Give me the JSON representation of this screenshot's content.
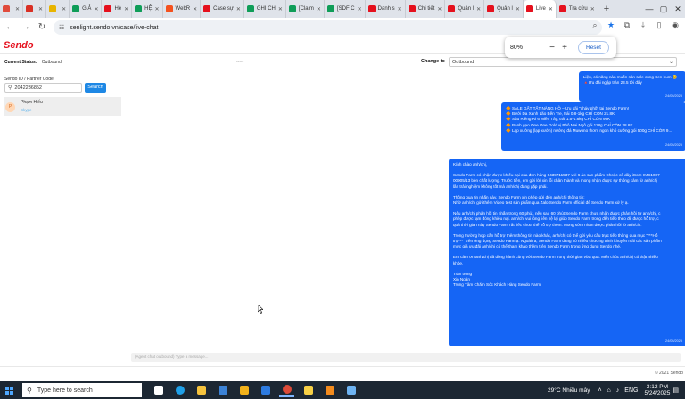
{
  "browser": {
    "tabs": [
      {
        "label": "",
        "color": "#e04b3c",
        "active": false,
        "icon": "gmail-icon"
      },
      {
        "label": "",
        "color": "#d93025",
        "active": false,
        "icon": "gmail-icon"
      },
      {
        "label": "",
        "color": "#e8b400",
        "active": false,
        "icon": "product-icon"
      },
      {
        "label": "GIẢ",
        "color": "#0f9d58",
        "active": false,
        "icon": "sheets-icon"
      },
      {
        "label": "Hệ",
        "color": "#e5101d",
        "active": false,
        "icon": "sendo-icon"
      },
      {
        "label": "HỆ",
        "color": "#0f9d58",
        "active": false,
        "icon": "sheets-icon"
      },
      {
        "label": "WebR",
        "color": "#f4511e",
        "active": false,
        "icon": "webr-icon"
      },
      {
        "label": "Case sự",
        "color": "#e5101d",
        "active": false,
        "icon": "sendo-icon"
      },
      {
        "label": "GHI CH",
        "color": "#0f9d58",
        "active": false,
        "icon": "sheets-icon"
      },
      {
        "label": "[Claim",
        "color": "#0f9d58",
        "active": false,
        "icon": "sheets-icon"
      },
      {
        "label": "[SDF C",
        "color": "#0f9d58",
        "active": false,
        "icon": "sheets-icon"
      },
      {
        "label": "Danh s",
        "color": "#e5101d",
        "active": false,
        "icon": "sendo-icon"
      },
      {
        "label": "Chi tiết",
        "color": "#e5101d",
        "active": false,
        "icon": "sendo-icon"
      },
      {
        "label": "Quản l",
        "color": "#e5101d",
        "active": false,
        "icon": "sendo-icon"
      },
      {
        "label": "Quản l",
        "color": "#e5101d",
        "active": false,
        "icon": "sendo-icon"
      },
      {
        "label": "Live",
        "color": "#e5101d",
        "active": true,
        "icon": "sendo-icon"
      },
      {
        "label": "Tra cứu",
        "color": "#e5101d",
        "active": false,
        "icon": "sendo-icon"
      }
    ],
    "url": "senlight.sendo.vn/case/live-chat",
    "zoom": {
      "percent": "80%",
      "minus": "−",
      "plus": "+",
      "reset_label": "Reset"
    }
  },
  "app": {
    "logo": "Sendo",
    "current_status_label": "Current Status:",
    "current_status_value": "Outbound",
    "status_placeholder": "-----",
    "change_to_label": "Change to",
    "change_to_value": "Outbound",
    "search_label": "Sendo ID / Partner Code",
    "search_value": "2042236852",
    "search_button": "Search",
    "conversation": {
      "name": "Phạm Hiếu",
      "sub": "Skype",
      "avatar": "P"
    },
    "composer_placeholder": "(Agent chat outbound) Type a message...",
    "copyright": "© 2021 Sendo"
  },
  "messages": [
    {
      "lines": [
        "Liệu, có năng nàn muốn sản sale cùng Sen hum 😊",
        "🔺Ưu đãi ngập tràn 23.5 tới đây"
      ],
      "time": "24/05/2025"
    },
    {
      "lines": [
        "🔶 SALE GẤT TẤT NĂNG HỒ – Ưu đãi \"cháy phố\" tại Sendo Farm!",
        "🔶 Bưởi Da Xanh Lão Bến Tre, trái 0.8-1kg CHỈ CÒN 21.8K",
        "🔶 Sầu Riêng Ri 6 Miền Tây, trái 1.5-1.8kg CHỈ CÒN 99K",
        "🔶 Bánh gạo One One Gold vị Phô Mai Ngô gói 118g CHỈ CÒN 28.8K",
        "🔶 Lạp xưởng (lạp xưởn) nướng đá Muwono thơm ngon khó cưỡng gói 500g CHỈ CÒN 9..."
      ],
      "time": "24/05/2025"
    },
    {
      "lines": [
        "Kính chào anh/chị,",
        "",
        "Sendo Farm có nhận được khiếu nại của đơn hàng 0439711537 với 6 áo sản phẩm Choộc cổ dây iCore IMC1007-",
        "00905/13 bên chất lượng. Trước tiên, em gửi lời xin lỗi chân thành và mong nhận được sự thông cảm từ anh/chị",
        "lần trải nghiệm không tốt mà anh/chị đang gặp phải.",
        "",
        "Thông qua tin nhắn này, Sendo Farm xin phép gửi đến anh/chị thông tin:",
        "Nhờ anh/chị gửi thêm Video test sản phẩm qua Zalo Sendo Farm official để Sendo Farm xử lý ạ.",
        "",
        "Nếu anh/chị phản hồi tin nhắn trong 60 phút, nếu sau 60 phút Sendo Farm chưa nhận được phản hồi từ anh/chị, c",
        "phép được tạm đóng khiếu nại. anh/chị vui lòng liên hệ lại giúp Sendo Farm trong đến tiếp theo để được hỗ trợ, c",
        "quá thời gian này Sendo Farm rất tiếc chưa thể hỗ trợ thêm. Mong sớm nhận được phản hồi từ anh/chị.",
        "",
        "Trong trường hợp cần hỗ trợ thêm thông tin nào khác, anh/chị có thể gửi yêu cầu trực tiếp thông qua mục \"***Hỗ",
        "trợ***\" trên ứng dụng Sendo Farm ạ. Ngoài ra, Sendo Farm đang có nhiều chương trình khuyến mãi các sản phẩm",
        "mức giá ưu đãi anh/chị có thể tham khảo thêm trên Sendo Farm trong ứng dụng Sendo nhé.",
        "",
        "Em cảm ơn anh/chị đã đồng hành cùng với Sendo Farm trong thời gian vừa qua. Mến chúc anh/chị có thật nhiều",
        "khỏe.",
        "",
        "Trân trọng",
        "Xin Ngân",
        "Trung Tâm Chăm Sóc Khách Hàng Sendo Farm"
      ],
      "time": "24/05/2025"
    }
  ],
  "taskbar": {
    "search_placeholder": "Type here to search",
    "weather": "29°C  Nhiều mây",
    "language": "ENG",
    "time": "3:12 PM",
    "date": "5/24/2025",
    "apps": [
      {
        "name": "task-view-icon",
        "color": "#ffffff"
      },
      {
        "name": "edge-icon",
        "color": "#1fa0e8"
      },
      {
        "name": "file-explorer-icon",
        "color": "#f4c23d"
      },
      {
        "name": "store-icon",
        "color": "#3b82d6"
      },
      {
        "name": "chrome-canary-icon",
        "color": "#f2b21b"
      },
      {
        "name": "mail-icon",
        "color": "#2d7be0"
      },
      {
        "name": "chrome-icon",
        "color": "#dd4b39"
      },
      {
        "name": "sticky-notes-icon",
        "color": "#f7d046"
      },
      {
        "name": "firefox-icon",
        "color": "#f28b1e"
      },
      {
        "name": "notepad-icon",
        "color": "#6db3f2"
      }
    ]
  }
}
